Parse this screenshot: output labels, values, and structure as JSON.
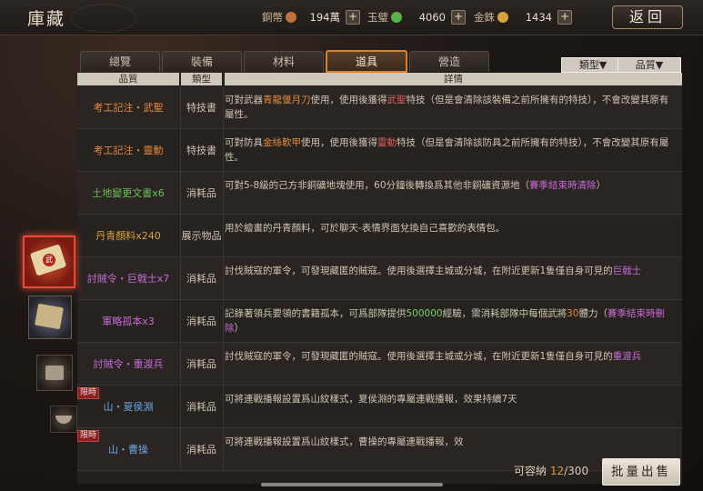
{
  "header": {
    "title": "庫藏",
    "back_label": "返回",
    "resources": [
      {
        "label": "銅幣",
        "value": "194萬",
        "color": "#c0703a"
      },
      {
        "label": "玉璧",
        "value": "4060",
        "color": "#5ab04a"
      },
      {
        "label": "金銖",
        "value": "1434",
        "color": "#d6a23c"
      }
    ],
    "plus": "+"
  },
  "tabs": [
    {
      "label": "總覽",
      "active": false
    },
    {
      "label": "裝備",
      "active": false
    },
    {
      "label": "材料",
      "active": false
    },
    {
      "label": "道具",
      "active": true
    },
    {
      "label": "營造",
      "active": false
    }
  ],
  "filters": {
    "type": "類型▼",
    "quality": "品質▼"
  },
  "table": {
    "headers": [
      "品質",
      "類型",
      "詳情"
    ],
    "rows": [
      {
        "name": "考工記注・武聖",
        "name_color": "orange",
        "type": "特技書",
        "desc_parts": [
          [
            "可對武器",
            ""
          ],
          [
            "青龍偃月刀",
            "orange"
          ],
          [
            "使用，使用後獲得",
            ""
          ],
          [
            "武聖",
            "red"
          ],
          [
            "特技（但是會清除該裝備之前所擁有的特技），不會改變其原有屬性。",
            ""
          ]
        ]
      },
      {
        "name": "考工記注・靈動",
        "name_color": "orange",
        "type": "特技書",
        "desc_parts": [
          [
            "可對防具",
            ""
          ],
          [
            "金絲軟甲",
            "orange"
          ],
          [
            "使用，使用後獲得",
            ""
          ],
          [
            "靈動",
            "red"
          ],
          [
            "特技（但是會清除該防具之前所擁有的特技），不會改變其原有屬性。",
            ""
          ]
        ]
      },
      {
        "name": "土地變更文書x6",
        "name_color": "green",
        "type": "消耗品",
        "desc_parts": [
          [
            "可對5-8級的己方非銅礦地塊使用，60分鐘後轉換爲其他非銅礦資源地（",
            ""
          ],
          [
            "賽季結束時清除",
            "purple"
          ],
          [
            "）",
            ""
          ]
        ]
      },
      {
        "name": "丹青顏料x240",
        "name_color": "gold",
        "type": "展示物品",
        "desc_parts": [
          [
            "用於繪畫的丹青顏料，可於聊天-表情界面兌換自己喜歡的表情包。",
            ""
          ]
        ]
      },
      {
        "name": "討賊令・巨戟士x7",
        "name_color": "purple",
        "type": "消耗品",
        "desc_parts": [
          [
            "討伐賊寇的軍令，可發現藏匿的賊寇。使用後選擇主城或分城，在附近更新1隻僅自身可見的",
            ""
          ],
          [
            "巨戟士",
            "purple"
          ]
        ]
      },
      {
        "name": "軍略孤本x3",
        "name_color": "purple",
        "type": "消耗品",
        "desc_parts": [
          [
            "記錄著領兵要領的書籍孤本，可爲部隊提供",
            ""
          ],
          [
            "500000",
            "green"
          ],
          [
            "經驗，需消耗部隊中每個武將",
            ""
          ],
          [
            "30",
            "orange"
          ],
          [
            "體力（",
            ""
          ],
          [
            "賽季結束時刪除",
            "purple"
          ],
          [
            "）",
            ""
          ]
        ]
      },
      {
        "name": "討賊令・重渡兵",
        "name_color": "purple",
        "type": "消耗品",
        "desc_parts": [
          [
            "討伐賊寇的軍令，可發現藏匿的賊寇。使用後選擇主城或分城，在附近更新1隻僅自身可見的",
            ""
          ],
          [
            "重渡兵",
            "purple"
          ]
        ]
      },
      {
        "name": "山・夏侯淵",
        "name_color": "blue",
        "type": "消耗品",
        "limited": "限時",
        "desc_parts": [
          [
            "可將連戰播報設置爲山紋樣式，夏侯淵的專屬連戰播報，效果持續7天",
            ""
          ]
        ]
      },
      {
        "name": "山・曹操",
        "name_color": "blue",
        "type": "消耗品",
        "limited": "限時",
        "desc_parts": [
          [
            "可將連戰播報設置爲山紋樣式，曹操的專屬連戰播報，效",
            ""
          ]
        ]
      }
    ]
  },
  "footer": {
    "capacity_label": "可容納",
    "capacity_used": "12",
    "capacity_total": "/300",
    "sell_label": "批量出售"
  },
  "icons": {
    "scroll_seal": "武"
  }
}
